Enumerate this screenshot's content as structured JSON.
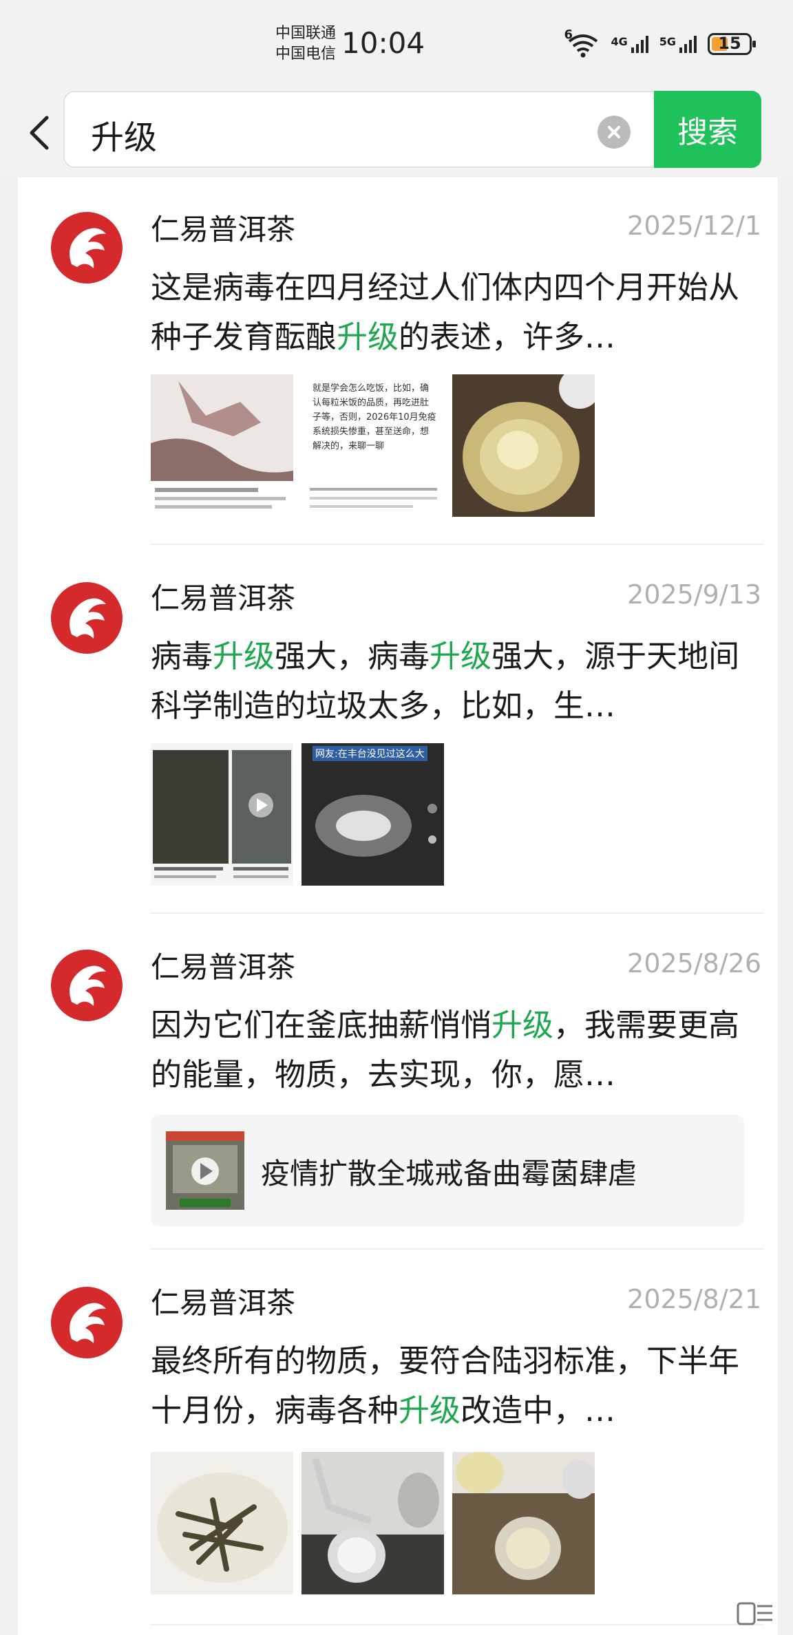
{
  "status_bar": {
    "carrier_1": "中国联通",
    "carrier_2": "中国电信",
    "time": "10:04",
    "wifi_badge": "6",
    "signal_1_label": "4G",
    "signal_2_label": "5G",
    "battery": "15",
    "battery_level": 0.15
  },
  "search": {
    "query": "升级",
    "button_label": "搜索",
    "accent_color": "#1fc15b"
  },
  "highlight_color": "#1fa750",
  "results": [
    {
      "author": "仁易普洱茶",
      "date": "2025/12/1",
      "text_before": "这是病毒在四月经过人们体内四个月开始从种子发育酝酿",
      "keyword": "升级",
      "text_after": "的表述，许多…",
      "image_texts": [
        "",
        "就是学会怎么吃饭，比如，确认每粒米饭的品质，再吃进肚子等，否则，2026年10月免疫系统损失惨重，甚至送命，想解决的，来聊一聊",
        ""
      ]
    },
    {
      "author": "仁易普洱茶",
      "date": "2025/9/13",
      "text_before": "病毒",
      "keyword": "升级",
      "text_mid": "强大，病毒",
      "keyword_2": "升级",
      "text_after": "强大，源于天地间科学制造的垃圾太多，比如，生…",
      "image_texts": [
        "",
        "网友:在丰台没见过这么大"
      ]
    },
    {
      "author": "仁易普洱茶",
      "date": "2025/8/26",
      "text_before": "因为它们在釜底抽薪悄悄",
      "keyword": "升级",
      "text_after": "，我需要更高的能量，物质，去实现，你，愿…",
      "video_card_title": "疫情扩散全城戒备曲霉菌肆虐"
    },
    {
      "author": "仁易普洱茶",
      "date": "2025/8/21",
      "text_before": "最终所有的物质，要符合陆羽标准，下半年十月份，病毒各种",
      "keyword": "升级",
      "text_after": "改造中，…"
    }
  ]
}
